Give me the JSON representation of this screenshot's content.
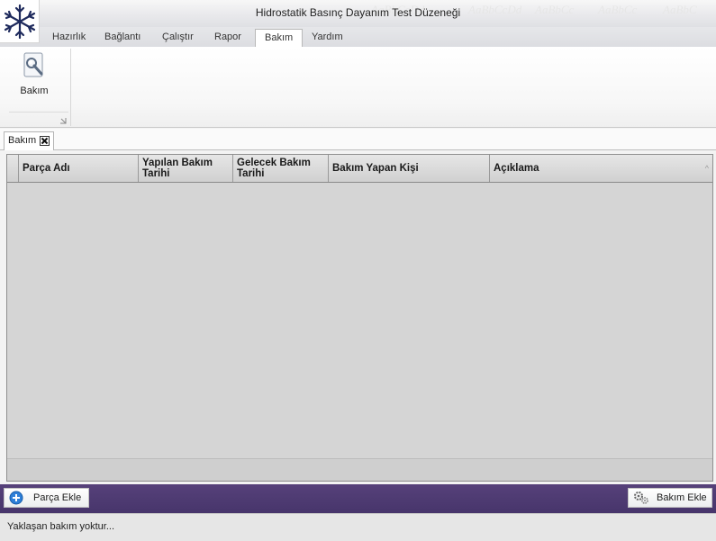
{
  "window": {
    "title": "Hidrostatik Basınç Dayanım Test Düzeneği"
  },
  "quick_access_ghosts": [
    "AaBbCcDd",
    "AaBbCcDd",
    "AaBbCc",
    "AaBbCc",
    "AaBbC"
  ],
  "menu_tabs": [
    {
      "label": "Hazırlık",
      "active": false
    },
    {
      "label": "Bağlantı",
      "active": false
    },
    {
      "label": "Çalıştır",
      "active": false
    },
    {
      "label": "Rapor",
      "active": false
    },
    {
      "label": "Bakım",
      "active": true
    },
    {
      "label": "Yardım",
      "active": false
    }
  ],
  "ribbon": {
    "buttons": [
      {
        "label": "Bakım",
        "icon": "wrench-gear-icon"
      }
    ]
  },
  "document_tab": {
    "label": "Bakım",
    "close_icon": "close-icon"
  },
  "grid": {
    "columns": [
      "Parça Adı",
      "Yapılan Bakım Tarihi",
      "Gelecek Bakım Tarihi",
      "Bakım Yapan Kişi",
      "Açıklama"
    ],
    "sort_glyph": "^",
    "rows": []
  },
  "actions": {
    "add_part": {
      "label": "Parça Ekle",
      "icon": "plus-circle-icon"
    },
    "add_maintenance": {
      "label": "Bakım Ekle",
      "icon": "gears-icon"
    }
  },
  "status": {
    "text": "Yaklaşan bakım yoktur..."
  },
  "colors": {
    "action_bar": "#4e3b75",
    "grid_bg": "#d5d5d5",
    "accent_blue": "#1f6fc9"
  }
}
